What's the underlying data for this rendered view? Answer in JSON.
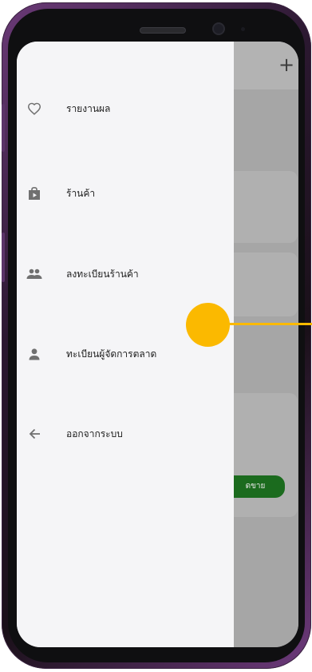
{
  "drawer": {
    "items": [
      {
        "icon": "heart-outline-icon",
        "label": "รายงานผล"
      },
      {
        "icon": "shop-bag-icon",
        "label": "ร้านค้า"
      },
      {
        "icon": "people-icon",
        "label": "ลงทะเบียนร้านค้า"
      },
      {
        "icon": "person-icon",
        "label": "ทะเบียนผู้จัดการตลาด"
      },
      {
        "icon": "arrow-left-icon",
        "label": "ออกจากระบบ"
      }
    ]
  },
  "app": {
    "plus_label": "+",
    "partial_button_label": "ดขาย"
  },
  "colors": {
    "highlight": "#fbb900",
    "drawer_bg": "#f5f5f7",
    "accent_green": "#1b6b1e"
  }
}
